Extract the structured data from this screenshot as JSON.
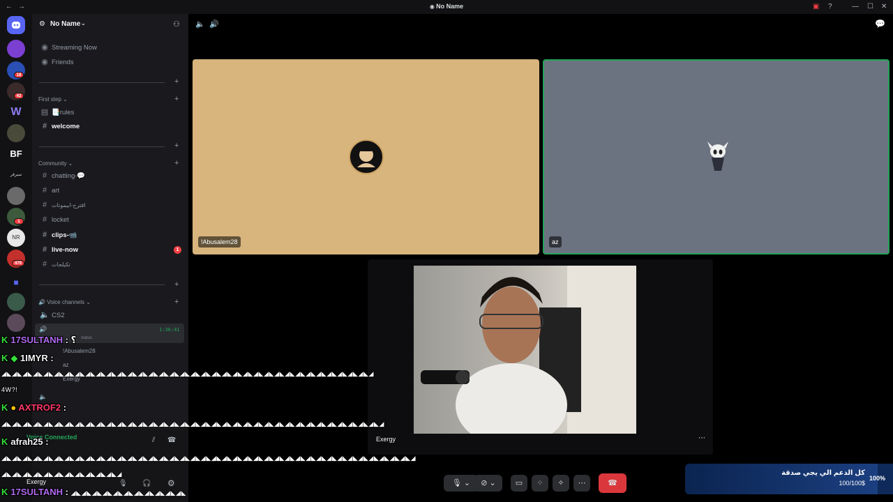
{
  "window": {
    "title": "No Name"
  },
  "server": {
    "name": "No Name"
  },
  "sidebar": {
    "top_items": [
      {
        "label": "Streaming Now"
      },
      {
        "label": "Friends"
      }
    ],
    "categories": {
      "first_step": "First step",
      "community": "Community",
      "voice": "Voice channels"
    },
    "channels": {
      "rules": "📑rules",
      "welcome": "welcome",
      "chatting": "chatting-💬",
      "art": "art",
      "suggestions": "اقترح-ابيموتات",
      "locket": "locket",
      "clips": "clips-📹",
      "live_now": "live-now",
      "live_now_badge": "1",
      "talk": "تكيلجات"
    },
    "voice": {
      "cs2": "CS2",
      "timer": "1:36:41",
      "status": "status",
      "users": [
        "!Abusalem28",
        "az",
        "Exergy"
      ],
      "connected_label": "Voice Connected",
      "self_name": "Exergy"
    }
  },
  "guild_badges": [
    "18",
    "42",
    "1",
    "1",
    "470"
  ],
  "call": {
    "tiles": [
      {
        "name": "!Abusalem28",
        "bg": "#d8b57d"
      },
      {
        "name": "az",
        "bg": "#6c7380"
      },
      {
        "name": "Exergy",
        "bg": "#0d0d0f"
      }
    ]
  },
  "chat_overlay": [
    {
      "user": "17SULTANH",
      "sep": ":",
      "text": "؟",
      "color": "#b06af0"
    },
    {
      "user": "1IMYR",
      "sep": ":",
      "text": "",
      "color": "#f2f3f5"
    },
    {
      "user": "",
      "sep": "",
      "text": "4W?!",
      "color": "#ffffff"
    },
    {
      "user": "AXTROF2",
      "sep": ":",
      "text": "",
      "color": "#ff3a6a"
    },
    {
      "user": "afrah25",
      "sep": ":",
      "text": "",
      "color": "#f2f3f5"
    },
    {
      "user": "17SULTANH",
      "sep": ":",
      "text": "",
      "color": "#b06af0"
    }
  ],
  "donation": {
    "text": "كل الدعم الي يجي صدقة",
    "amount": "100/100$",
    "percent": "100%"
  }
}
